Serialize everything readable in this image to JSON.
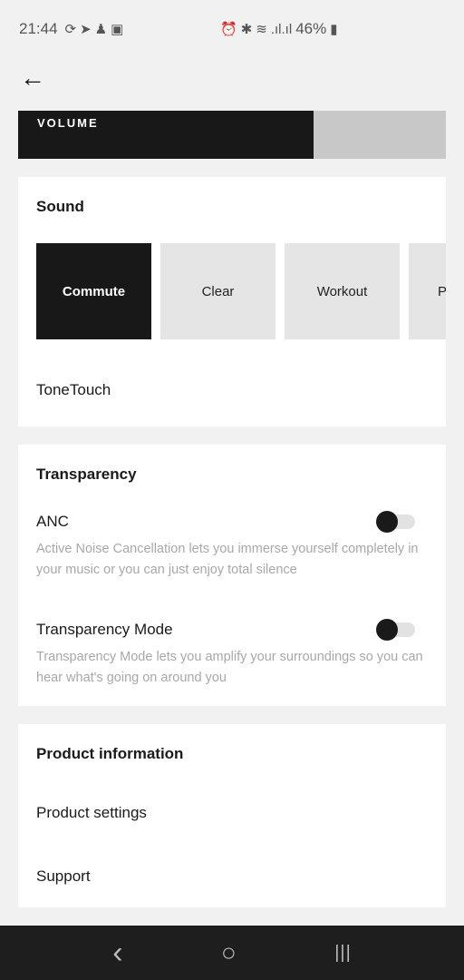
{
  "status_bar": {
    "time": "21:44",
    "notification_icons": [
      "sync-icon",
      "telegram-icon",
      "snapchat-icon",
      "image-icon"
    ],
    "system_icons": [
      "alarm-icon",
      "bluetooth-icon",
      "wifi-icon",
      "signal-icon",
      "signal-icon"
    ],
    "battery": "46%"
  },
  "header": {
    "back_icon": "arrow-left-icon"
  },
  "volume": {
    "label": "VOLUME",
    "level_percent": 69
  },
  "sound": {
    "title": "Sound",
    "presets": [
      {
        "label": "Commute",
        "active": true
      },
      {
        "label": "Clear",
        "active": false
      },
      {
        "label": "Workout",
        "active": false
      },
      {
        "label": "P",
        "active": false
      }
    ],
    "tonetouch": "ToneTouch"
  },
  "transparency": {
    "title": "Transparency",
    "anc": {
      "label": "ANC",
      "description": "Active Noise Cancellation lets you immerse yourself completely in your music or you can just enjoy total silence",
      "enabled": false
    },
    "mode": {
      "label": "Transparency Mode",
      "description": "Transparency Mode lets you amplify your surroundings so you can hear what's going on around you",
      "enabled": false
    }
  },
  "product": {
    "title": "Product information",
    "items": [
      "Product settings",
      "Support"
    ]
  },
  "nav": {
    "back": "‹",
    "home": "○",
    "recents": "|||"
  }
}
